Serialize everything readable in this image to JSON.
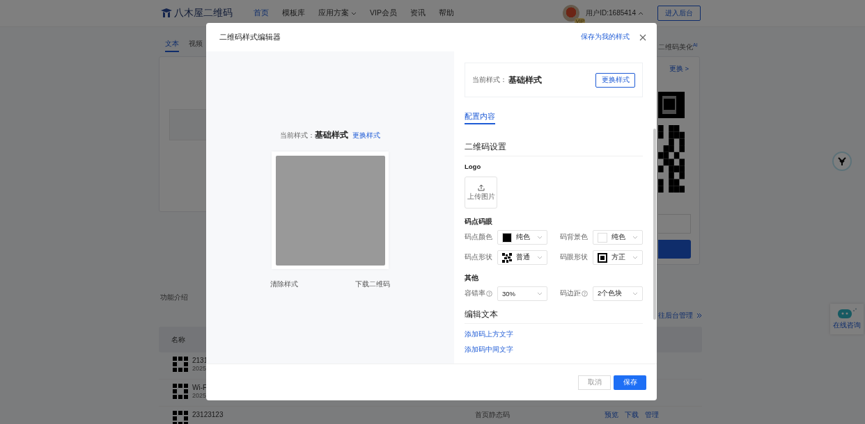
{
  "header": {
    "logo": "八木屋二维码",
    "nav": [
      {
        "label": "首页",
        "selected": true,
        "dropdown": false
      },
      {
        "label": "模板库",
        "selected": false,
        "dropdown": false
      },
      {
        "label": "应用方案",
        "selected": false,
        "dropdown": true
      },
      {
        "label": "VIP会员",
        "selected": false,
        "dropdown": false
      },
      {
        "label": "资讯",
        "selected": false,
        "dropdown": false
      },
      {
        "label": "帮助",
        "selected": false,
        "dropdown": false
      }
    ],
    "vip_badge": "VIP",
    "user": "用户ID:1685414",
    "console_button": "进入后台"
  },
  "page": {
    "tabs": [
      {
        "label": "文本",
        "selected": true
      },
      {
        "label": "视频",
        "selected": false
      }
    ],
    "beautify": {
      "title": "二维码美化",
      "badge": "AI",
      "change_link": "更换 >"
    },
    "section_tabs": [
      {
        "label": "功能介绍",
        "selected": false
      }
    ],
    "manage_link": "往后台管理",
    "table": {
      "columns": [
        "名称"
      ],
      "rows": [
        {
          "name": "2131",
          "date": "2025"
        },
        {
          "name": "Wi-F",
          "date": "2025"
        },
        {
          "name": "23123123",
          "type": "首页静态码",
          "actions": [
            "预览",
            "下载",
            "管理"
          ]
        }
      ]
    },
    "chat_widget": "在线咨询"
  },
  "modal": {
    "title": "二维码样式编辑器",
    "save_as_link": "保存为我的样式",
    "preview": {
      "style_label": "当前样式：",
      "style_name": "基础样式",
      "change_link": "更换样式",
      "clear_link": "清除样式",
      "download_link": "下载二维码"
    },
    "current_style": {
      "label": "当前样式：",
      "name": "基础样式",
      "button": "更换样式"
    },
    "tabs": [
      {
        "label": "配置内容",
        "selected": true
      }
    ],
    "qr_settings": {
      "title": "二维码设置",
      "logo_label": "Logo",
      "upload_label": "上传图片",
      "dots": {
        "title": "码点码眼",
        "fields": [
          {
            "label": "码点颜色",
            "value": "纯色",
            "kind": "color",
            "color": "#000000",
            "help": false
          },
          {
            "label": "码背景色",
            "value": "纯色",
            "kind": "color",
            "color": "#ffffff",
            "help": false
          },
          {
            "label": "码点形状",
            "value": "普通",
            "kind": "dot-shape",
            "help": false
          },
          {
            "label": "码眼形状",
            "value": "方正",
            "kind": "eye-shape",
            "help": false
          }
        ]
      },
      "other": {
        "title": "其他",
        "fields": [
          {
            "label": "容错率",
            "value": "30%",
            "help": true
          },
          {
            "label": "码边距",
            "value": "2个色块",
            "help": true
          }
        ]
      }
    },
    "edit_text": {
      "title": "编辑文本",
      "links": [
        "添加码上方文字",
        "添加码中间文字"
      ]
    },
    "buttons": {
      "cancel": "取消",
      "save": "保存"
    }
  }
}
